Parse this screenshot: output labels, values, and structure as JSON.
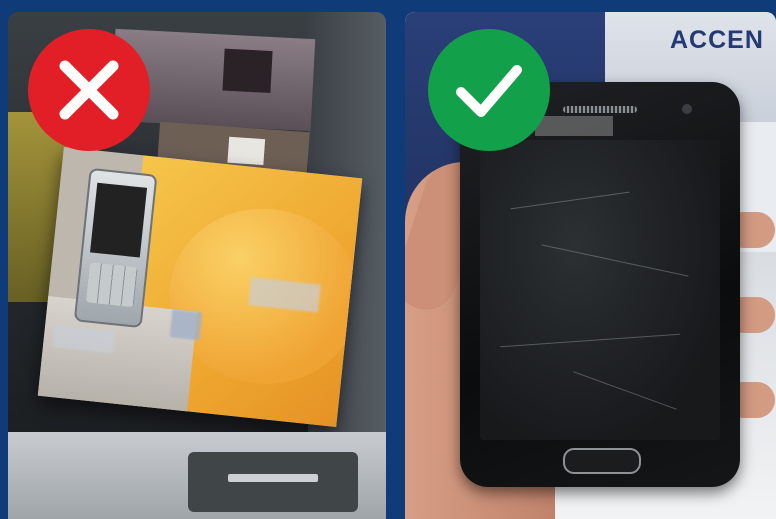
{
  "left_panel": {
    "verdict_icon": "x-mark-icon",
    "verdict_color": "#e21f26",
    "scene": "boxed-feature-phone-in-bin"
  },
  "right_panel": {
    "verdict_icon": "check-mark-icon",
    "verdict_color": "#12a04a",
    "scene": "hand-holding-bare-smartphone",
    "background_sign_text": "ACCEN"
  },
  "colors": {
    "frame": "#0f3b78"
  }
}
